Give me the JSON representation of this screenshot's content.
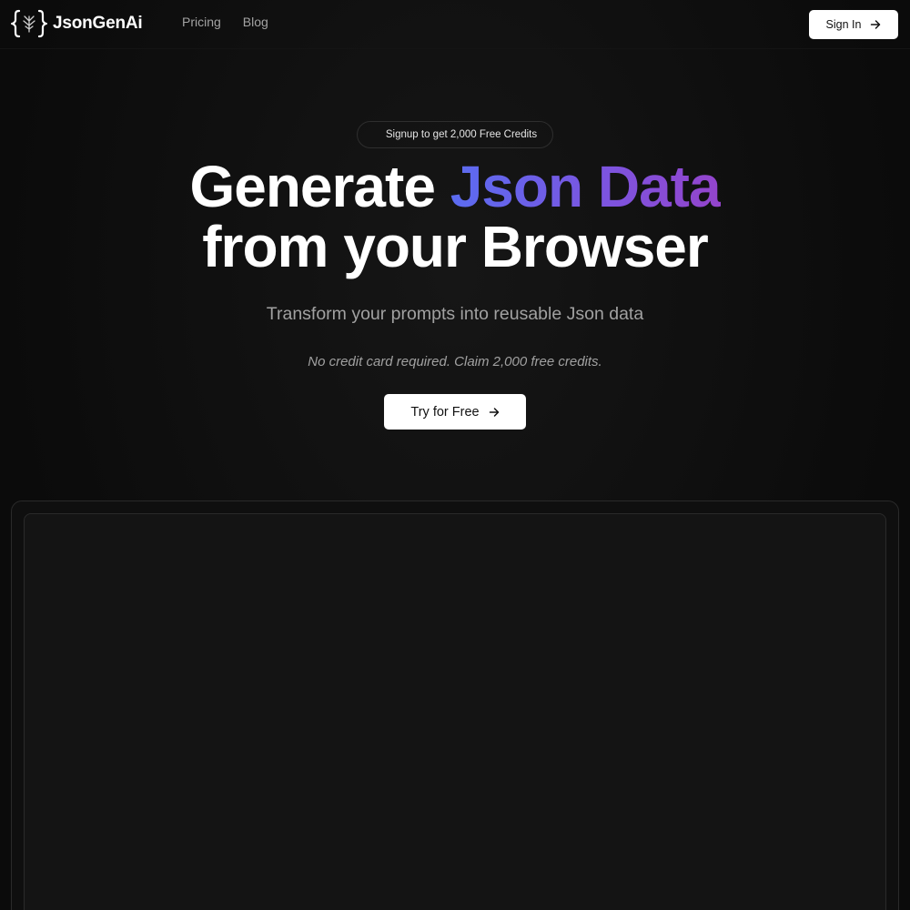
{
  "header": {
    "brand": "JsonGenAi",
    "nav": [
      "Pricing",
      "Blog"
    ],
    "signin_label": "Sign In"
  },
  "hero": {
    "badge": "Signup to get 2,000 Free Credits",
    "headline_part1": "Generate ",
    "headline_accent": "Json Data",
    "headline_part2": "from your Browser",
    "subtitle": "Transform your prompts into reusable Json data",
    "note": "No credit card required. Claim 2,000 free credits.",
    "cta_label": "Try for Free"
  },
  "icons": {
    "logo": "braces-tree-icon",
    "arrow": "arrow-right-icon"
  },
  "colors": {
    "background": "#0b0b0b",
    "accent_start": "#5b6cf0",
    "accent_end": "#9444cc",
    "button_bg": "#ffffff"
  }
}
